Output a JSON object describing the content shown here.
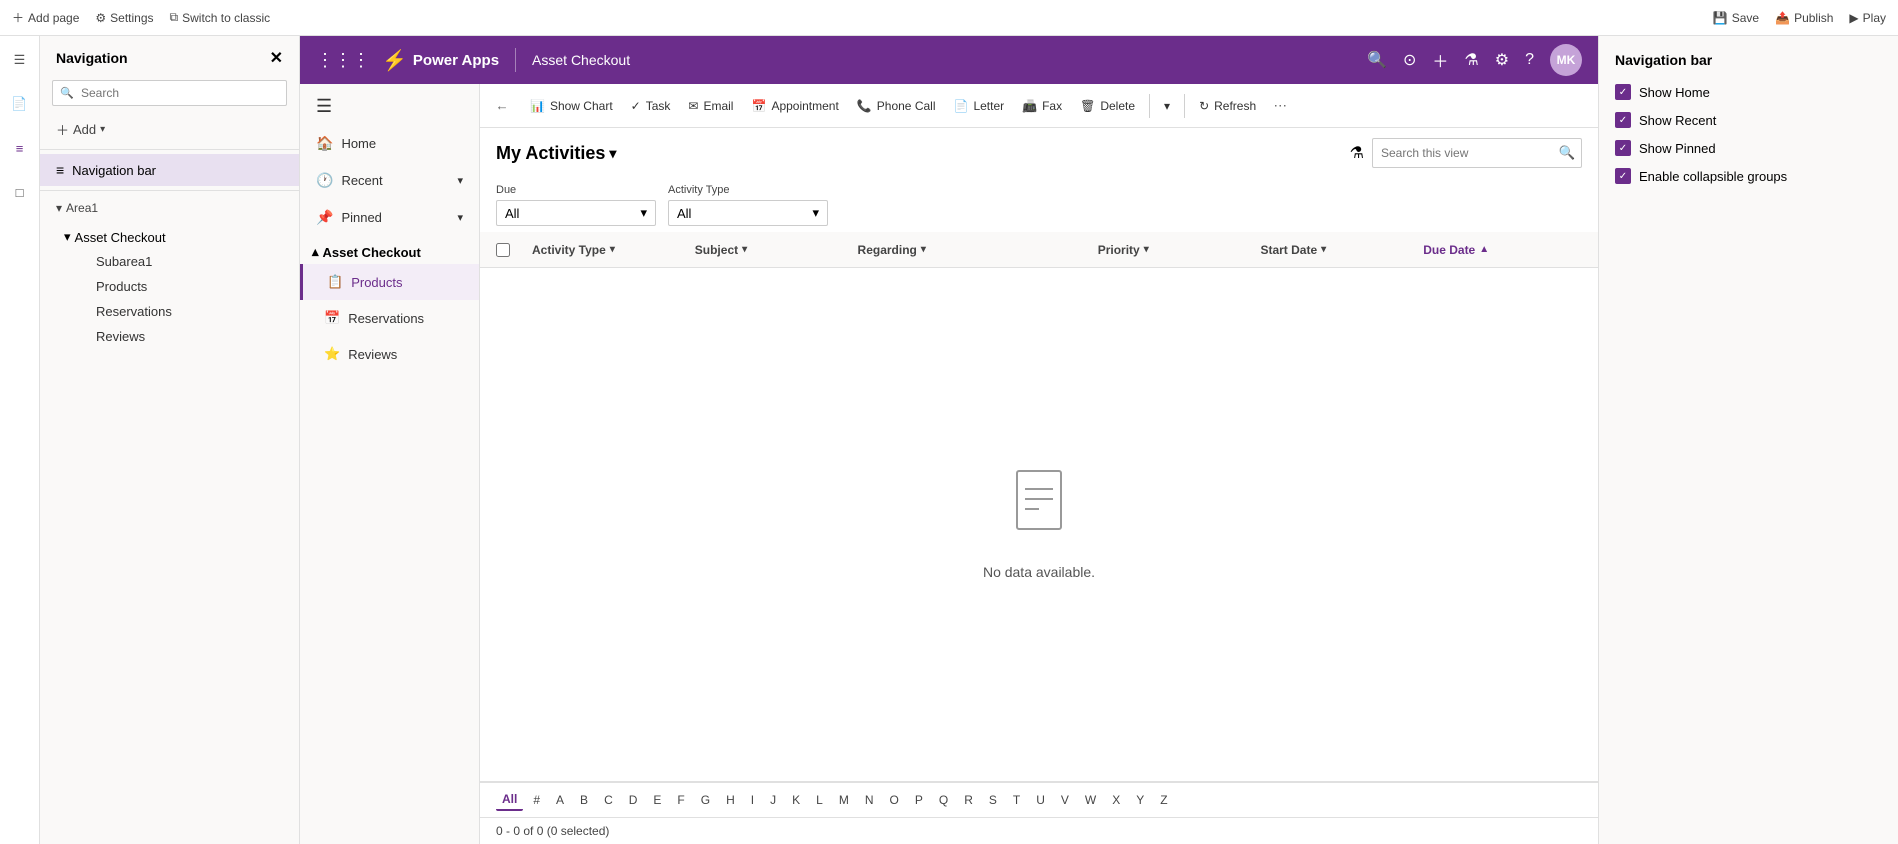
{
  "topbar": {
    "add_page_label": "Add page",
    "settings_label": "Settings",
    "switch_label": "Switch to classic",
    "save_label": "Save",
    "publish_label": "Publish",
    "play_label": "Play"
  },
  "nav_panel": {
    "title": "Navigation",
    "search_placeholder": "Search",
    "add_label": "Add",
    "navigation_bar_label": "Navigation bar",
    "area1_label": "Area1",
    "asset_checkout_label": "Asset Checkout",
    "subarea1_label": "Subarea1",
    "products_label": "Products",
    "reservations_label": "Reservations",
    "reviews_label": "Reviews"
  },
  "power_apps_header": {
    "app_name": "Power Apps",
    "page_title": "Asset Checkout",
    "avatar_initials": "MK"
  },
  "toolbar": {
    "back_label": "←",
    "show_chart_label": "Show Chart",
    "task_label": "Task",
    "email_label": "Email",
    "appointment_label": "Appointment",
    "phone_call_label": "Phone Call",
    "letter_label": "Letter",
    "fax_label": "Fax",
    "delete_label": "Delete",
    "refresh_label": "Refresh"
  },
  "view": {
    "title": "My Activities",
    "search_placeholder": "Search this view",
    "filter_due_label": "Due",
    "filter_due_value": "All",
    "filter_activity_type_label": "Activity Type",
    "filter_activity_type_value": "All",
    "columns": [
      {
        "label": "Activity Type",
        "sort": "down"
      },
      {
        "label": "Subject",
        "sort": "down"
      },
      {
        "label": "Regarding",
        "sort": "down"
      },
      {
        "label": "Priority",
        "sort": "down"
      },
      {
        "label": "Start Date",
        "sort": "down"
      },
      {
        "label": "Due Date",
        "sort": "up-active"
      }
    ],
    "empty_text": "No data available.",
    "record_count": "0 - 0 of 0 (0 selected)"
  },
  "pagination": {
    "letters": [
      "All",
      "#",
      "A",
      "B",
      "C",
      "D",
      "E",
      "F",
      "G",
      "H",
      "I",
      "J",
      "K",
      "L",
      "M",
      "N",
      "O",
      "P",
      "Q",
      "R",
      "S",
      "T",
      "U",
      "V",
      "W",
      "X",
      "Y",
      "Z"
    ],
    "active": "All"
  },
  "mid_nav": {
    "items": [
      {
        "label": "Home",
        "icon": "🏠"
      },
      {
        "label": "Recent",
        "icon": "🕐"
      },
      {
        "label": "Pinned",
        "icon": "📌"
      },
      {
        "label": "Asset Checkout",
        "icon": ""
      }
    ],
    "sub_items": [
      {
        "label": "Products",
        "active": true
      },
      {
        "label": "Reservations",
        "active": false
      },
      {
        "label": "Reviews",
        "active": false
      }
    ]
  },
  "right_panel": {
    "title": "Navigation bar",
    "checkboxes": [
      {
        "label": "Show Home",
        "checked": true
      },
      {
        "label": "Show Recent",
        "checked": true
      },
      {
        "label": "Show Pinned",
        "checked": true
      },
      {
        "label": "Enable collapsible groups",
        "checked": true
      }
    ]
  }
}
